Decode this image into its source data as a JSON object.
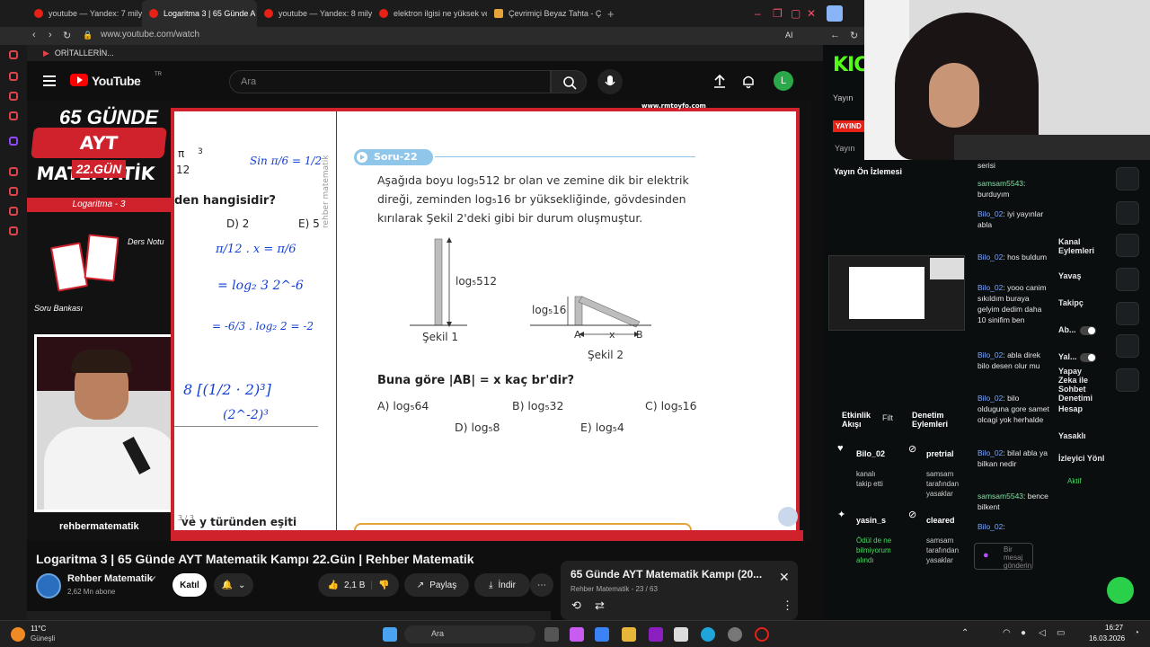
{
  "browser": {
    "tabs": [
      {
        "label": "youtube — Yandex: 7 milyo",
        "active": false
      },
      {
        "label": "Logaritma 3 | 65 Günde A",
        "active": true
      },
      {
        "label": "youtube — Yandex: 8 milyo",
        "active": false
      },
      {
        "label": "elektron ilgisi ne yüksek ve",
        "active": false
      },
      {
        "label": "Çevrimiçi Beyaz Tahta - Ç",
        "active": false
      }
    ],
    "url": "www.youtube.com/watch",
    "bookmark": "ORİTALLERİN...",
    "ai_label": "AI"
  },
  "youtube": {
    "logo": "YouTube",
    "region": "TR",
    "search_placeholder": "Ara",
    "avatar_letter": "L"
  },
  "video": {
    "brand_65": "65 GÜNDE",
    "brand_ayt": "AYT MATEMATİK",
    "brand_day": "22.GÜN",
    "topic": "Logaritma - 3",
    "ders_notu": "Ders Notu",
    "soru_bankasi": "Soru Bankası",
    "watermark": "rehbermatematik",
    "site": "www.rmtoyfo.com",
    "vertical_text": "rehber matematik",
    "page_counter": "3 / 3",
    "left_col": {
      "pi12": "π",
      "twelve": "12",
      "cube": "3",
      "question_tail": "den hangisidir?",
      "options": [
        "D) 2",
        "E) 5"
      ],
      "bottom_text": "ve y türünden eşiti"
    },
    "handwriting": {
      "sin": "Sin π/6 = 1/2",
      "line1": "π/12 . x = π/6",
      "line2": "= log₂ 3 2^-6",
      "line3": "= -6/3 . log₂ 2 = -2",
      "line4": "8 [(1/2 · 2)³]",
      "line5": "(2^-2)³"
    },
    "question": {
      "badge": "Soru-22",
      "text": "Aşağıda boyu log₅512 br olan ve zemine dik bir elektrik direği, zeminden log₅16 br yüksekliğinde, gövdesinden kırılarak Şekil 2'deki gibi bir durum oluşmuştur.",
      "fig1_label": "log₅512",
      "fig1_caption": "Şekil 1",
      "fig2_label": "log₅16",
      "fig2_caption": "Şekil 2",
      "fig2_a": "A",
      "fig2_b": "B",
      "fig2_x": "x",
      "prompt": "Buna göre |AB| = x kaç br'dir?",
      "options": [
        "A) log₅64",
        "B) log₅32",
        "C) log₅16",
        "D) log₅8",
        "E) log₅4"
      ]
    }
  },
  "below_video": {
    "title": "Logaritma 3 | 65 Günde AYT Matematik Kampı 22.Gün | Rehber Matematik",
    "channel": "Rehber Matematik",
    "subscribers": "2,62 Mn abone",
    "joined_label": "Katıl",
    "likes": "2,1 B",
    "share": "Paylaş",
    "download": "İndir",
    "playlist_title": "65 Günde AYT Matematik Kampı (20...",
    "playlist_meta": "Rehber Matematik - 23 / 63"
  },
  "kick": {
    "logo": "KIC",
    "yayin_label": "Yayın",
    "yayinda_badge": "YAYIND",
    "yayin_small": "Yayın",
    "preview_title": "Yayın Ön İzlemesi",
    "chat": [
      {
        "user": "",
        "msg": "serisi"
      },
      {
        "user": "samsam5543",
        "msg": ": burduyım"
      },
      {
        "user": "Bilo_02",
        "msg": ": iyi yayınlar abla"
      },
      {
        "user": "Bilo_02",
        "msg": ": hos buldum"
      },
      {
        "user": "Bilo_02",
        "msg": ": yooo canim sıkıldım buraya gelyim dedim daha 10 sinifim ben"
      },
      {
        "user": "Bilo_02",
        "msg": ": abla direk bilo desen olur mu"
      },
      {
        "user": "Bilo_02",
        "msg": ": bilo olduguna gore samet olcagi yok herhalde"
      },
      {
        "user": "Bilo_02",
        "msg": ": bilal abla ya bilkan nedir"
      },
      {
        "user": "samsam5543",
        "msg": ": bence bilkent"
      },
      {
        "user": "Bilo_02",
        "msg": ":"
      }
    ],
    "chat_input_placeholder": "Bir mesaj gönderin",
    "actions": {
      "title": "Kanal Eylemleri",
      "items": [
        "Yavaş",
        "Takipç",
        "Ab...",
        "Yal...",
        "Yapay Zeka ile Sohbet Denetimi",
        "Hesap",
        "Yasaklı",
        "İzleyici Yönl"
      ],
      "status": "Aktif"
    },
    "activity": {
      "title": "Etkinlik Akışı",
      "filter": "Filt",
      "items": [
        {
          "user": "Bilo_02",
          "desc": "kanalı takip etti"
        },
        {
          "user": "yasin_s",
          "desc": "Ödül de ne bilmiyorum alındı"
        }
      ]
    },
    "moderation": {
      "title": "Denetim Eylemleri",
      "items": [
        {
          "user": "pretrial",
          "desc": "samsam tarafından yasaklar"
        },
        {
          "user": "cleared",
          "desc": "samsam tarafından yasaklar"
        }
      ]
    }
  },
  "taskbar": {
    "weather_temp": "11°C",
    "weather_desc": "Güneşli",
    "search_label": "Ara",
    "time": "16:27",
    "date": "16.03.2026"
  },
  "colors": {
    "youtube_red": "#ff0000",
    "brand_red": "#d0222d",
    "kick_green": "#53fc18",
    "ink_blue": "#1440d8"
  }
}
